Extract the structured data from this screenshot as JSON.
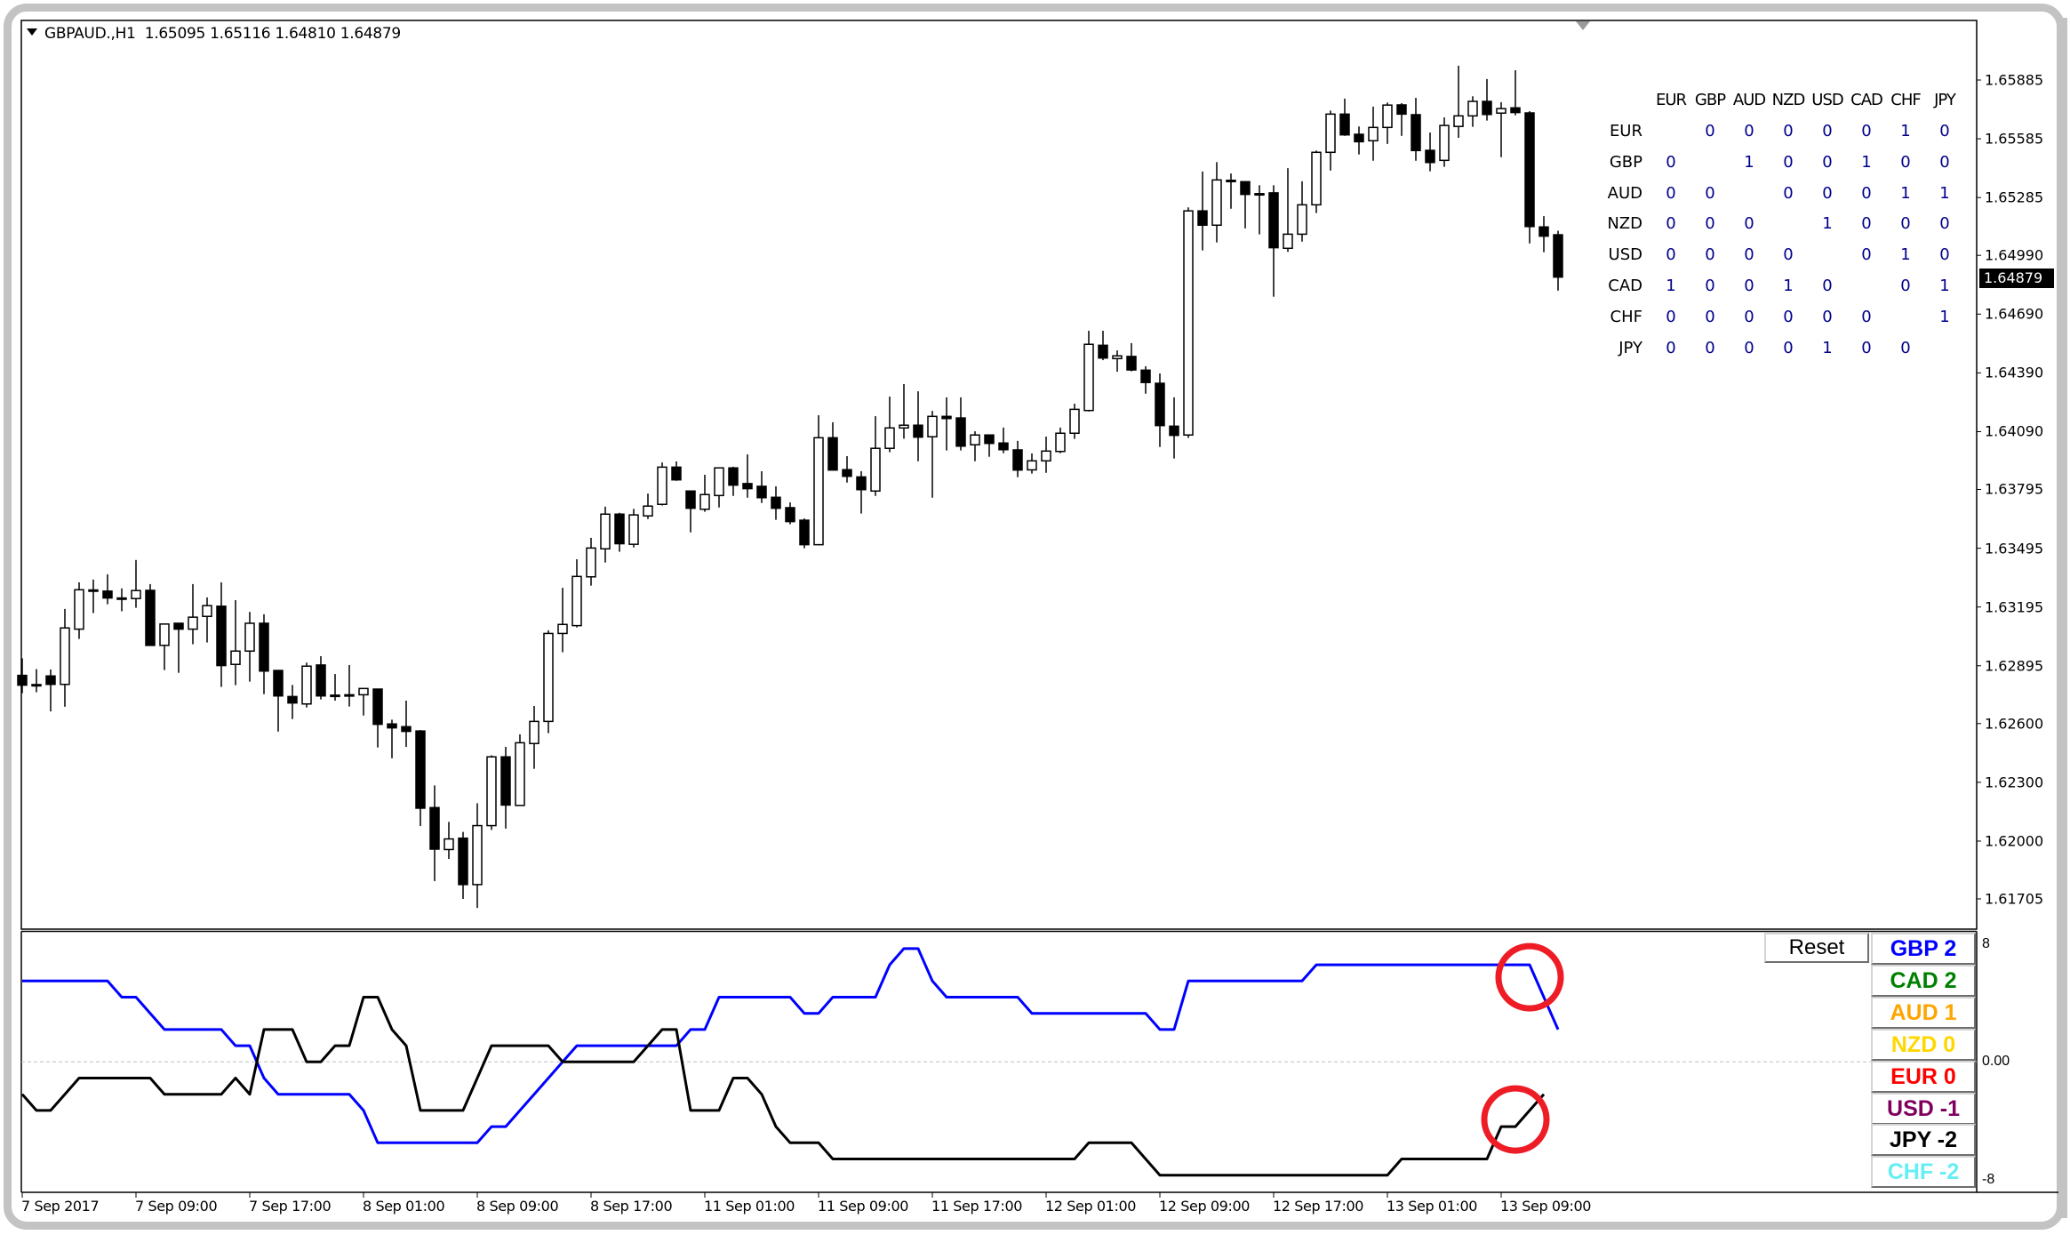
{
  "header": {
    "symbol": "GBPAUD.,H1",
    "ohlc_text": "1.65095 1.65116 1.64810 1.64879"
  },
  "price_axis": {
    "labels": [
      "1.65885",
      "1.65585",
      "1.65285",
      "1.64990",
      "1.64690",
      "1.64390",
      "1.64090",
      "1.63795",
      "1.63495",
      "1.63195",
      "1.62895",
      "1.62600",
      "1.62300",
      "1.62000",
      "1.61705"
    ],
    "current_price": "1.64879"
  },
  "time_axis": {
    "labels": [
      "7 Sep 2017",
      "7 Sep 09:00",
      "7 Sep 17:00",
      "8 Sep 01:00",
      "8 Sep 09:00",
      "8 Sep 17:00",
      "11 Sep 01:00",
      "11 Sep 09:00",
      "11 Sep 17:00",
      "12 Sep 01:00",
      "12 Sep 09:00",
      "12 Sep 17:00",
      "13 Sep 01:00",
      "13 Sep 09:00"
    ],
    "label_bar_index": [
      0,
      8,
      16,
      24,
      32,
      40,
      48,
      56,
      64,
      72,
      80,
      88,
      96,
      104
    ]
  },
  "matrix": {
    "columns": [
      "EUR",
      "GBP",
      "AUD",
      "NZD",
      "USD",
      "CAD",
      "CHF",
      "JPY"
    ],
    "rows": [
      {
        "label": "EUR",
        "values": [
          "",
          "0",
          "0",
          "0",
          "0",
          "0",
          "1",
          "0"
        ]
      },
      {
        "label": "GBP",
        "values": [
          "0",
          "",
          "1",
          "0",
          "0",
          "1",
          "0",
          "0"
        ]
      },
      {
        "label": "AUD",
        "values": [
          "0",
          "0",
          "",
          "0",
          "0",
          "0",
          "1",
          "1"
        ]
      },
      {
        "label": "NZD",
        "values": [
          "0",
          "0",
          "0",
          "",
          "1",
          "0",
          "0",
          "0"
        ]
      },
      {
        "label": "USD",
        "values": [
          "0",
          "0",
          "0",
          "0",
          "",
          "0",
          "1",
          "0"
        ]
      },
      {
        "label": "CAD",
        "values": [
          "1",
          "0",
          "0",
          "1",
          "0",
          "",
          "0",
          "1"
        ]
      },
      {
        "label": "CHF",
        "values": [
          "0",
          "0",
          "0",
          "0",
          "0",
          "0",
          "",
          "1"
        ]
      },
      {
        "label": "JPY",
        "values": [
          "0",
          "0",
          "0",
          "0",
          "1",
          "0",
          "0",
          ""
        ]
      }
    ]
  },
  "indicator": {
    "axis_labels": {
      "top": "8",
      "zero": "0.00",
      "bottom": "-8"
    },
    "reset_label": "Reset",
    "legend": [
      {
        "label": "GBP 2",
        "color": "#0000ff"
      },
      {
        "label": "CAD 2",
        "color": "#008000"
      },
      {
        "label": "AUD 1",
        "color": "#ffa500"
      },
      {
        "label": "NZD 0",
        "color": "#ffd700"
      },
      {
        "label": "EUR 0",
        "color": "#ff0000"
      },
      {
        "label": "USD -1",
        "color": "#800060"
      },
      {
        "label": "JPY -2",
        "color": "#000000"
      },
      {
        "label": "CHF -2",
        "color": "#66eef5"
      }
    ]
  },
  "colors": {
    "bull_body": "#ffffff",
    "bear_body": "#000000",
    "candle_outline": "#000000",
    "annotation_circle": "#ee1c25",
    "grid_zero": "#c0c0c0"
  },
  "chart_data": [
    {
      "type": "candlestick",
      "title": "GBPAUD.,H1",
      "ylim": [
        1.6162,
        1.6604
      ],
      "ylabel": "",
      "xlabel": "",
      "grid": false,
      "x_start": "7 Sep 2017",
      "interval": "H1",
      "candles": [
        [
          1.62846,
          1.62933,
          1.62755,
          1.62796
        ],
        [
          1.62799,
          1.62878,
          1.6276,
          1.62799
        ],
        [
          1.62843,
          1.62876,
          1.62662,
          1.628
        ],
        [
          1.628,
          1.63185,
          1.62686,
          1.63088
        ],
        [
          1.63082,
          1.63321,
          1.63032,
          1.63283
        ],
        [
          1.63282,
          1.63335,
          1.63164,
          1.63282
        ],
        [
          1.63276,
          1.63362,
          1.63209,
          1.63241
        ],
        [
          1.63241,
          1.6329,
          1.63173,
          1.63241
        ],
        [
          1.63238,
          1.63435,
          1.63191,
          1.63279
        ],
        [
          1.6328,
          1.63312,
          1.62999,
          1.62999
        ],
        [
          1.62999,
          1.63108,
          1.62873,
          1.63108
        ],
        [
          1.63112,
          1.63112,
          1.62859,
          1.63082
        ],
        [
          1.63082,
          1.63312,
          1.63005,
          1.63143
        ],
        [
          1.63147,
          1.63244,
          1.63014,
          1.63202
        ],
        [
          1.63199,
          1.63321,
          1.62787,
          1.62896
        ],
        [
          1.62902,
          1.6323,
          1.62796,
          1.6297
        ],
        [
          1.6297,
          1.6317,
          1.62814,
          1.63112
        ],
        [
          1.63112,
          1.63158,
          1.6275,
          1.62868
        ],
        [
          1.62871,
          1.62874,
          1.62559,
          1.62741
        ],
        [
          1.62738,
          1.62797,
          1.62623,
          1.62705
        ],
        [
          1.627,
          1.62911,
          1.62682,
          1.62893
        ],
        [
          1.62899,
          1.62944,
          1.62723,
          1.62741
        ],
        [
          1.62745,
          1.62853,
          1.62717,
          1.62745
        ],
        [
          1.62747,
          1.62899,
          1.62687,
          1.62747
        ],
        [
          1.62747,
          1.62779,
          1.62641,
          1.62779
        ],
        [
          1.62776,
          1.62776,
          1.62478,
          1.62596
        ],
        [
          1.62598,
          1.6262,
          1.62423,
          1.62578
        ],
        [
          1.62584,
          1.62717,
          1.62481,
          1.6256
        ],
        [
          1.62562,
          1.62567,
          1.62077,
          1.62168
        ],
        [
          1.62171,
          1.62284,
          1.61796,
          1.61959
        ],
        [
          1.61957,
          1.62098,
          1.61909,
          1.62011
        ],
        [
          1.62015,
          1.62047,
          1.61705,
          1.61778
        ],
        [
          1.61778,
          1.62193,
          1.61659,
          1.62079
        ],
        [
          1.62079,
          1.62438,
          1.62057,
          1.6243
        ],
        [
          1.6243,
          1.62481,
          1.62064,
          1.62184
        ],
        [
          1.62182,
          1.62545,
          1.62182,
          1.62502
        ],
        [
          1.62498,
          1.6269,
          1.62369,
          1.62611
        ],
        [
          1.62611,
          1.63076,
          1.62551,
          1.6306
        ],
        [
          1.6306,
          1.63293,
          1.62964,
          1.63106
        ],
        [
          1.631,
          1.63439,
          1.63091,
          1.63351
        ],
        [
          1.63349,
          1.63548,
          1.63304,
          1.63496
        ],
        [
          1.63492,
          1.63707,
          1.63422,
          1.63669
        ],
        [
          1.63669,
          1.63676,
          1.63477,
          1.63518
        ],
        [
          1.63515,
          1.63696,
          1.63499,
          1.63665
        ],
        [
          1.6366,
          1.63774,
          1.63644,
          1.6371
        ],
        [
          1.63719,
          1.63933,
          1.63713,
          1.63909
        ],
        [
          1.63909,
          1.63938,
          1.63839,
          1.63844
        ],
        [
          1.63787,
          1.63787,
          1.63576,
          1.63699
        ],
        [
          1.63694,
          1.6387,
          1.63681,
          1.63769
        ],
        [
          1.63764,
          1.63905,
          1.63703,
          1.63905
        ],
        [
          1.63905,
          1.63911,
          1.63762,
          1.63817
        ],
        [
          1.63825,
          1.63974,
          1.63753,
          1.63799
        ],
        [
          1.63811,
          1.63888,
          1.63726,
          1.63753
        ],
        [
          1.63755,
          1.63811,
          1.6364,
          1.63699
        ],
        [
          1.63702,
          1.63729,
          1.63617,
          1.63631
        ],
        [
          1.63638,
          1.63647,
          1.63495,
          1.63513
        ],
        [
          1.63513,
          1.64174,
          1.6351,
          1.64059
        ],
        [
          1.64059,
          1.64138,
          1.63894,
          1.63894
        ],
        [
          1.63896,
          1.63965,
          1.6383,
          1.63862
        ],
        [
          1.63859,
          1.63888,
          1.63672,
          1.63794
        ],
        [
          1.63787,
          1.64169,
          1.63762,
          1.64005
        ],
        [
          1.64005,
          1.64269,
          1.63985,
          1.64109
        ],
        [
          1.64109,
          1.64333,
          1.64054,
          1.64123
        ],
        [
          1.64123,
          1.64296,
          1.63939,
          1.64062
        ],
        [
          1.64064,
          1.64196,
          1.63753,
          1.64168
        ],
        [
          1.64168,
          1.64265,
          1.63994,
          1.64157
        ],
        [
          1.6416,
          1.64265,
          1.63994,
          1.64016
        ],
        [
          1.64023,
          1.64092,
          1.63939,
          1.64073
        ],
        [
          1.64073,
          1.64073,
          1.63962,
          1.6403
        ],
        [
          1.64032,
          1.64111,
          1.6398,
          1.63998
        ],
        [
          1.63997,
          1.64043,
          1.63858,
          1.63894
        ],
        [
          1.63895,
          1.63979,
          1.63876,
          1.63941
        ],
        [
          1.63941,
          1.64065,
          1.6388,
          1.63991
        ],
        [
          1.63989,
          1.64111,
          1.6398,
          1.64082
        ],
        [
          1.64082,
          1.64233,
          1.64053,
          1.64204
        ],
        [
          1.64198,
          1.64605,
          1.64193,
          1.64536
        ],
        [
          1.64531,
          1.64605,
          1.64455,
          1.64466
        ],
        [
          1.64463,
          1.64505,
          1.64396,
          1.64477
        ],
        [
          1.64474,
          1.64542,
          1.64398,
          1.64405
        ],
        [
          1.64404,
          1.64424,
          1.64284,
          1.64341
        ],
        [
          1.64337,
          1.64387,
          1.64012,
          1.64121
        ],
        [
          1.64118,
          1.64265,
          1.63953,
          1.64071
        ],
        [
          1.64073,
          1.65235,
          1.64058,
          1.65217
        ],
        [
          1.65217,
          1.65418,
          1.65015,
          1.65144
        ],
        [
          1.65144,
          1.65466,
          1.65056,
          1.65375
        ],
        [
          1.65373,
          1.65408,
          1.65228,
          1.65373
        ],
        [
          1.65366,
          1.65366,
          1.65128,
          1.65301
        ],
        [
          1.65305,
          1.65348,
          1.65097,
          1.65305
        ],
        [
          1.65309,
          1.65348,
          1.64779,
          1.65029
        ],
        [
          1.65026,
          1.65435,
          1.65008,
          1.65098
        ],
        [
          1.65098,
          1.65368,
          1.6506,
          1.65248
        ],
        [
          1.65248,
          1.65525,
          1.65206,
          1.65516
        ],
        [
          1.65516,
          1.65729,
          1.65423,
          1.65711
        ],
        [
          1.65711,
          1.6579,
          1.656,
          1.65605
        ],
        [
          1.65608,
          1.65648,
          1.65505,
          1.6557
        ],
        [
          1.65575,
          1.65749,
          1.65473,
          1.65643
        ],
        [
          1.65643,
          1.6577,
          1.65559,
          1.65757
        ],
        [
          1.65758,
          1.65767,
          1.656,
          1.65711
        ],
        [
          1.65708,
          1.65794,
          1.65473,
          1.65525
        ],
        [
          1.65526,
          1.65617,
          1.65419,
          1.65464
        ],
        [
          1.65475,
          1.65694,
          1.65442,
          1.65653
        ],
        [
          1.65648,
          1.65958,
          1.6559,
          1.65702
        ],
        [
          1.65702,
          1.65802,
          1.65646,
          1.65776
        ],
        [
          1.65776,
          1.6589,
          1.65678,
          1.65709
        ],
        [
          1.65716,
          1.65772,
          1.65491,
          1.65739
        ],
        [
          1.65743,
          1.65935,
          1.65705,
          1.65719
        ],
        [
          1.65717,
          1.65726,
          1.65051,
          1.65137
        ],
        [
          1.65135,
          1.6519,
          1.65006,
          1.65088
        ],
        [
          1.65095,
          1.65116,
          1.6481,
          1.64879
        ]
      ],
      "candle_fields": [
        "open",
        "high",
        "low",
        "close"
      ]
    },
    {
      "type": "line",
      "title": "Currency strength",
      "ylim": [
        -8,
        8
      ],
      "series": [
        {
          "name": "GBP",
          "color": "#0000ff",
          "values": [
            5,
            5,
            5,
            5,
            5,
            5,
            5,
            4,
            4,
            3,
            2,
            2,
            2,
            2,
            2,
            1,
            1,
            -1,
            -2,
            -2,
            -2,
            -2,
            -2,
            -2,
            -3,
            -5,
            -5,
            -5,
            -5,
            -5,
            -5,
            -5,
            -5,
            -4,
            -4,
            -3,
            -2,
            -1,
            0,
            1,
            1,
            1,
            1,
            1,
            1,
            1,
            1,
            2,
            2,
            4,
            4,
            4,
            4,
            4,
            4,
            3,
            3,
            4,
            4,
            4,
            4,
            6,
            7,
            7,
            5,
            4,
            4,
            4,
            4,
            4,
            4,
            3,
            3,
            3,
            3,
            3,
            3,
            3,
            3,
            3,
            2,
            2,
            5,
            5,
            5,
            5,
            5,
            5,
            5,
            5,
            5,
            6,
            6,
            6,
            6,
            6,
            6,
            6,
            6,
            6,
            6,
            6,
            6,
            6,
            6,
            6,
            6,
            4,
            2
          ]
        },
        {
          "name": "JPY",
          "color": "#000000",
          "values": [
            -2,
            -3,
            -3,
            -2,
            -1,
            -1,
            -1,
            -1,
            -1,
            -1,
            -2,
            -2,
            -2,
            -2,
            -2,
            -1,
            -2,
            2,
            2,
            2,
            0,
            0,
            1,
            1,
            4,
            4,
            2,
            1,
            -3,
            -3,
            -3,
            -3,
            -1,
            1,
            1,
            1,
            1,
            1,
            0,
            0,
            0,
            0,
            0,
            0,
            1,
            2,
            2,
            -3,
            -3,
            -3,
            -1,
            -1,
            -2,
            -4,
            -5,
            -5,
            -5,
            -6,
            -6,
            -6,
            -6,
            -6,
            -6,
            -6,
            -6,
            -6,
            -6,
            -6,
            -6,
            -6,
            -6,
            -6,
            -6,
            -6,
            -6,
            -5,
            -5,
            -5,
            -5,
            -6,
            -7,
            -7,
            -7,
            -7,
            -7,
            -7,
            -7,
            -7,
            -7,
            -7,
            -7,
            -7,
            -7,
            -7,
            -7,
            -7,
            -7,
            -6,
            -6,
            -6,
            -6,
            -6,
            -6,
            -6,
            -4,
            -4,
            -3,
            -2
          ]
        }
      ],
      "zero_line": true,
      "annotations": [
        {
          "type": "circle",
          "series": "GBP",
          "bar_index": 106
        },
        {
          "type": "circle",
          "series": "JPY",
          "bar_index": 105
        }
      ]
    }
  ]
}
